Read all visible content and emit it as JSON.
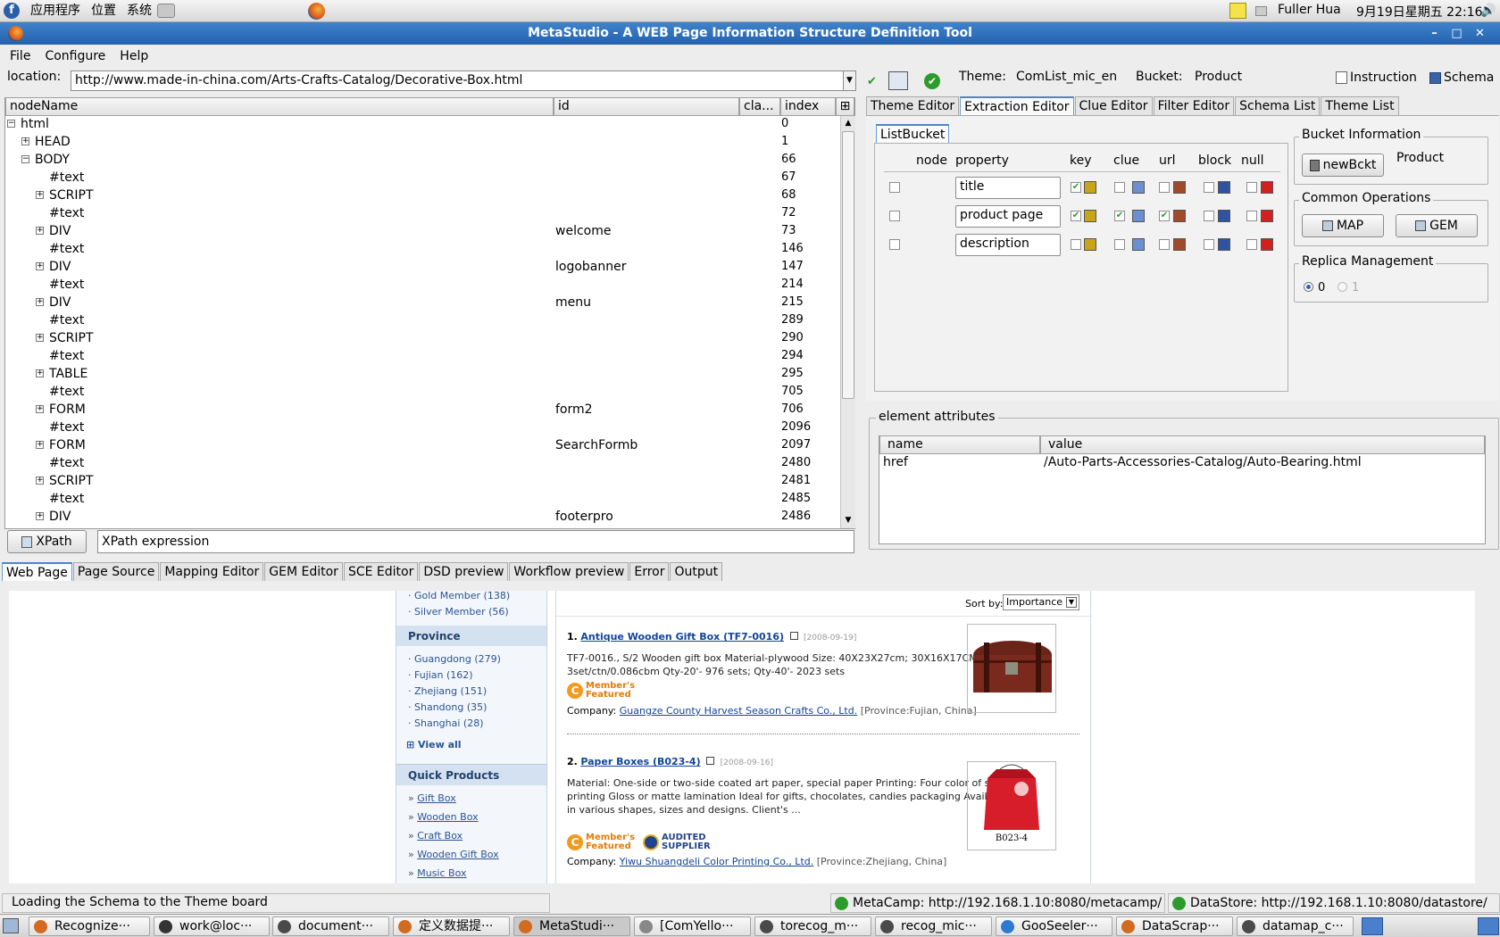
{
  "system_panel": {
    "menus": [
      "应用程序",
      "位置",
      "系统"
    ],
    "user": "Fuller Hua",
    "datetime": "9月19日星期五 22:16"
  },
  "window": {
    "title": "MetaStudio - A WEB Page Information Structure Definition Tool"
  },
  "menu": [
    "File",
    "Configure",
    "Help"
  ],
  "location": {
    "label": "location:",
    "url": "http://www.made-in-china.com/Arts-Crafts-Catalog/Decorative-Box.html"
  },
  "theme": {
    "label": "Theme:",
    "value": "ComList_mic_en",
    "bucket_label": "Bucket:",
    "bucket_value": "Product"
  },
  "toolbar": {
    "instruction": "Instruction",
    "schema": "Schema"
  },
  "tree": {
    "columns": [
      "nodeName",
      "id",
      "cla...",
      "index"
    ],
    "rows": [
      {
        "name": "html",
        "id": "",
        "index": "0",
        "level": 0,
        "exp": "minus"
      },
      {
        "name": "HEAD",
        "id": "",
        "index": "1",
        "level": 1,
        "exp": "plus"
      },
      {
        "name": "BODY",
        "id": "",
        "index": "66",
        "level": 1,
        "exp": "minus"
      },
      {
        "name": "#text",
        "id": "",
        "index": "67",
        "level": 2,
        "exp": ""
      },
      {
        "name": "SCRIPT",
        "id": "",
        "index": "68",
        "level": 2,
        "exp": "plus"
      },
      {
        "name": "#text",
        "id": "",
        "index": "72",
        "level": 2,
        "exp": ""
      },
      {
        "name": "DIV",
        "id": "welcome",
        "index": "73",
        "level": 2,
        "exp": "plus"
      },
      {
        "name": "#text",
        "id": "",
        "index": "146",
        "level": 2,
        "exp": ""
      },
      {
        "name": "DIV",
        "id": "logobanner",
        "index": "147",
        "level": 2,
        "exp": "plus"
      },
      {
        "name": "#text",
        "id": "",
        "index": "214",
        "level": 2,
        "exp": ""
      },
      {
        "name": "DIV",
        "id": "menu",
        "index": "215",
        "level": 2,
        "exp": "plus"
      },
      {
        "name": "#text",
        "id": "",
        "index": "289",
        "level": 2,
        "exp": ""
      },
      {
        "name": "SCRIPT",
        "id": "",
        "index": "290",
        "level": 2,
        "exp": "plus"
      },
      {
        "name": "#text",
        "id": "",
        "index": "294",
        "level": 2,
        "exp": ""
      },
      {
        "name": "TABLE",
        "id": "",
        "index": "295",
        "level": 2,
        "exp": "plus"
      },
      {
        "name": "#text",
        "id": "",
        "index": "705",
        "level": 2,
        "exp": ""
      },
      {
        "name": "FORM",
        "id": "form2",
        "index": "706",
        "level": 2,
        "exp": "plus"
      },
      {
        "name": "#text",
        "id": "",
        "index": "2096",
        "level": 2,
        "exp": ""
      },
      {
        "name": "FORM",
        "id": "SearchFormb",
        "index": "2097",
        "level": 2,
        "exp": "plus"
      },
      {
        "name": "#text",
        "id": "",
        "index": "2480",
        "level": 2,
        "exp": ""
      },
      {
        "name": "SCRIPT",
        "id": "",
        "index": "2481",
        "level": 2,
        "exp": "plus"
      },
      {
        "name": "#text",
        "id": "",
        "index": "2485",
        "level": 2,
        "exp": ""
      },
      {
        "name": "DIV",
        "id": "footerpro",
        "index": "2486",
        "level": 2,
        "exp": "plus"
      }
    ]
  },
  "xpath": {
    "button": "XPath",
    "placeholder": "XPath expression"
  },
  "editor_tabs": [
    "Theme Editor",
    "Extraction Editor",
    "Clue Editor",
    "Filter Editor",
    "Schema List",
    "Theme List"
  ],
  "list_bucket": {
    "tab": "ListBucket",
    "columns": [
      "node",
      "property",
      "key",
      "clue",
      "url",
      "block",
      "null"
    ],
    "rows": [
      {
        "property": "title"
      },
      {
        "property": "product page"
      },
      {
        "property": "description"
      }
    ]
  },
  "bucket_info": {
    "title": "Bucket Information",
    "new_button": "newBckt",
    "value": "Product"
  },
  "common_ops": {
    "title": "Common Operations",
    "map": "MAP",
    "gem": "GEM"
  },
  "replica": {
    "title": "Replica Management",
    "options": [
      "0",
      "1"
    ]
  },
  "element_attributes": {
    "title": "element attributes",
    "columns": [
      "name",
      "value"
    ],
    "rows": [
      {
        "name": "href",
        "value": "/Auto-Parts-Accessories-Catalog/Auto-Bearing.html"
      }
    ]
  },
  "bottom_tabs": [
    "Web Page",
    "Page Source",
    "Mapping Editor",
    "GEM Editor",
    "SCE Editor",
    "DSD preview",
    "Workflow preview",
    "Error",
    "Output"
  ],
  "web": {
    "members": [
      "Gold Member (138)",
      "Silver Member (56)"
    ],
    "province_title": "Province",
    "provinces": [
      "Guangdong (279)",
      "Fujian (162)",
      "Zhejiang (151)",
      "Shandong (35)",
      "Shanghai (28)"
    ],
    "view_all": "View all",
    "quick_title": "Quick Products",
    "quick": [
      "Gift Box",
      "Wooden Box",
      "Craft Box",
      "Wooden Gift Box",
      "Music Box"
    ],
    "sort_label": "Sort by:",
    "sort_value": "Importance",
    "products": [
      {
        "num": "1.",
        "title": "Antique Wooden Gift Box (TF7-0016)",
        "date": "[2008-09-19]",
        "desc1": "TF7-0016., S/2 Wooden gift box Material-plywood Size: 40X23X27cm; 30X16X17CM",
        "desc2": "3set/ctn/0.086cbm Qty-20'- 976 sets; Qty-40'- 2023 sets",
        "company_label": "Company:",
        "company": "Guangze County Harvest Season Crafts Co., Ltd.",
        "province": "[Province:Fujian, China]"
      },
      {
        "num": "2.",
        "title": "Paper Boxes (B023-4)",
        "date": "[2008-09-16]",
        "desc1": "Material: One-side or two-side coated art paper, special paper Printing: Four color of set",
        "desc2": "printing Gloss or matte lamination Ideal for gifts, chocolates, candies packaging Available",
        "desc3": "in various shapes, sizes and designs. Client's ...",
        "company_label": "Company:",
        "company": "Yiwu Shuangdeli Color Printing Co., Ltd.",
        "province": "[Province:Zhejiang, China]",
        "img_caption": "B023-4"
      }
    ],
    "badge1": "Member's",
    "badge2": "Featured",
    "audited1": "AUDITED",
    "audited2": "SUPPLIER"
  },
  "status": {
    "message": "Loading the Schema to the Theme board",
    "metacamp": "MetaCamp: http://192.168.1.10:8080/metacamp/",
    "datastore": "DataStore: http://192.168.1.10:8080/datastore/"
  },
  "taskbar": [
    "Recognize···",
    "work@loc···",
    "document···",
    "定义数据提···",
    "MetaStudi···",
    "[ComYello···",
    "torecog_m···",
    "recog_mic···",
    "GooSeeler···",
    "DataScrap···",
    "datamap_c···"
  ]
}
